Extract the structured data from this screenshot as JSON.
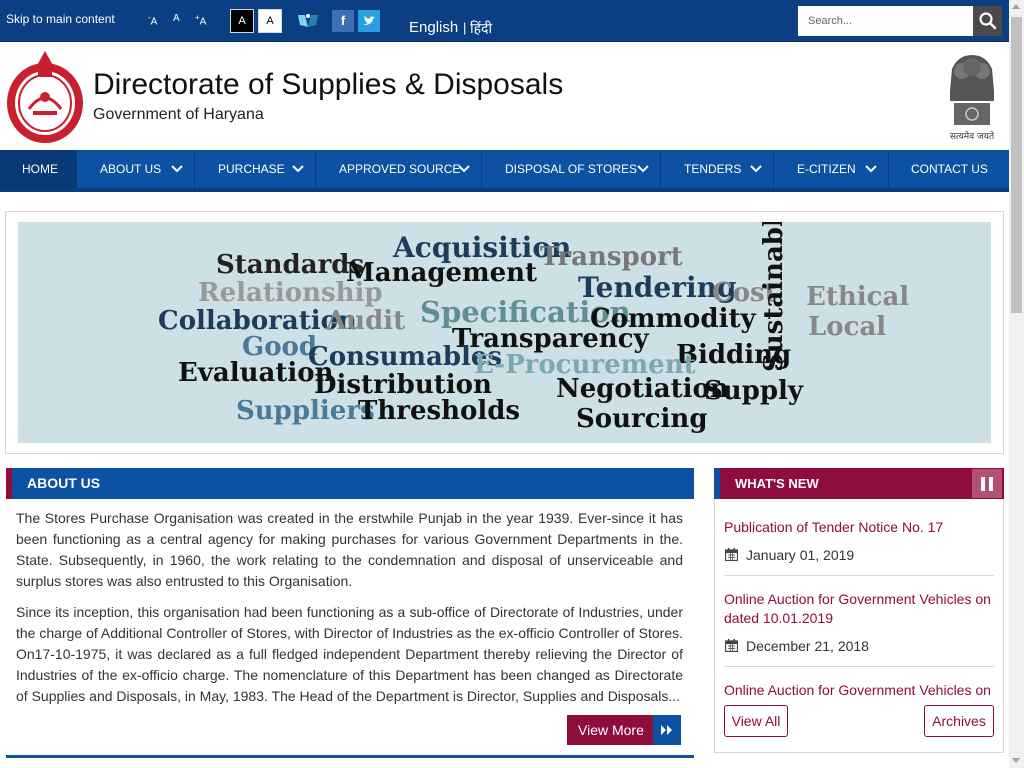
{
  "colors": {
    "nav_blue": "#0d51a3",
    "top_blue": "#0b3e82",
    "maroon": "#8e0d3c",
    "banner_bg": "#cde0e6"
  },
  "topbar": {
    "skip_link": "Skip to main content",
    "font_decrease": "A",
    "font_normal": "A",
    "font_increase": "A",
    "contrast_dark": "A",
    "contrast_light": "A",
    "screen_reader_icon": "screen-reader-icon",
    "social": {
      "facebook": "f",
      "twitter": "t"
    },
    "lang_english": "English",
    "lang_separator": "|",
    "lang_hindi": "हिंदी",
    "search_placeholder": "Search..."
  },
  "header": {
    "title": "Directorate of Supplies & Disposals",
    "subtitle": "Government of Haryana",
    "emblem_motto": "सत्यमेव जयते"
  },
  "nav": {
    "items": [
      {
        "label": "HOME",
        "dropdown": false
      },
      {
        "label": "ABOUT US",
        "dropdown": true
      },
      {
        "label": "PURCHASE",
        "dropdown": true
      },
      {
        "label": "APPROVED SOURCE",
        "dropdown": true
      },
      {
        "label": "DISPOSAL OF STORES",
        "dropdown": true
      },
      {
        "label": "TENDERS",
        "dropdown": true
      },
      {
        "label": "E-CITIZEN",
        "dropdown": true
      },
      {
        "label": "CONTACT US",
        "dropdown": false
      }
    ]
  },
  "banner": {
    "words": [
      "Acquisition",
      "Transport",
      "Standards",
      "Management",
      "Tendering",
      "Cost",
      "Sustainable",
      "Ethical",
      "Relationship",
      "Specification",
      "Local",
      "Collaboration",
      "Audit",
      "Commodity",
      "Transparency",
      "Good",
      "Consumables",
      "Bidding",
      "E-Procurement",
      "Evaluation",
      "Distribution",
      "Negotiation",
      "Supply",
      "Suppliers",
      "Thresholds",
      "Sourcing"
    ]
  },
  "about": {
    "heading": "ABOUT US",
    "para1": "The Stores Purchase Organisation was created in the erstwhile Punjab in the year 1939. Ever-since it has been functioning as a central agency for making purchases for various Government Departments in the. State. Subsequently, in 1960, the work relating to the condemnation and disposal of unserviceable and surplus stores was also entrusted to this Organisation.",
    "para2": "Since its inception, this organisation had been functioning as a sub-office of Directorate of Industries, under the charge of Additional Controller of Stores, with Director of Industries as the ex-officio Controller of Stores. On17-10-1975, it was declared as a full fledged independent Department thereby relieving the Director of Industries of the ex-officio charge. The nomenclature of this Department has been changed as Directorate of Supplies and Disposals, in May, 1983. The Head of the Department is Director, Supplies and Disposals...",
    "view_more": "View More"
  },
  "whats_new": {
    "heading": "WHAT'S NEW",
    "items": [
      {
        "title": "Publication of Tender Notice No. 17",
        "date": "January 01, 2019"
      },
      {
        "title": "Online Auction for Government Vehicles on dated 10.01.2019",
        "date": "December 21, 2018"
      },
      {
        "title": "Online Auction for Government Vehicles on",
        "date": ""
      }
    ],
    "view_all": "View All",
    "archives": "Archives"
  }
}
